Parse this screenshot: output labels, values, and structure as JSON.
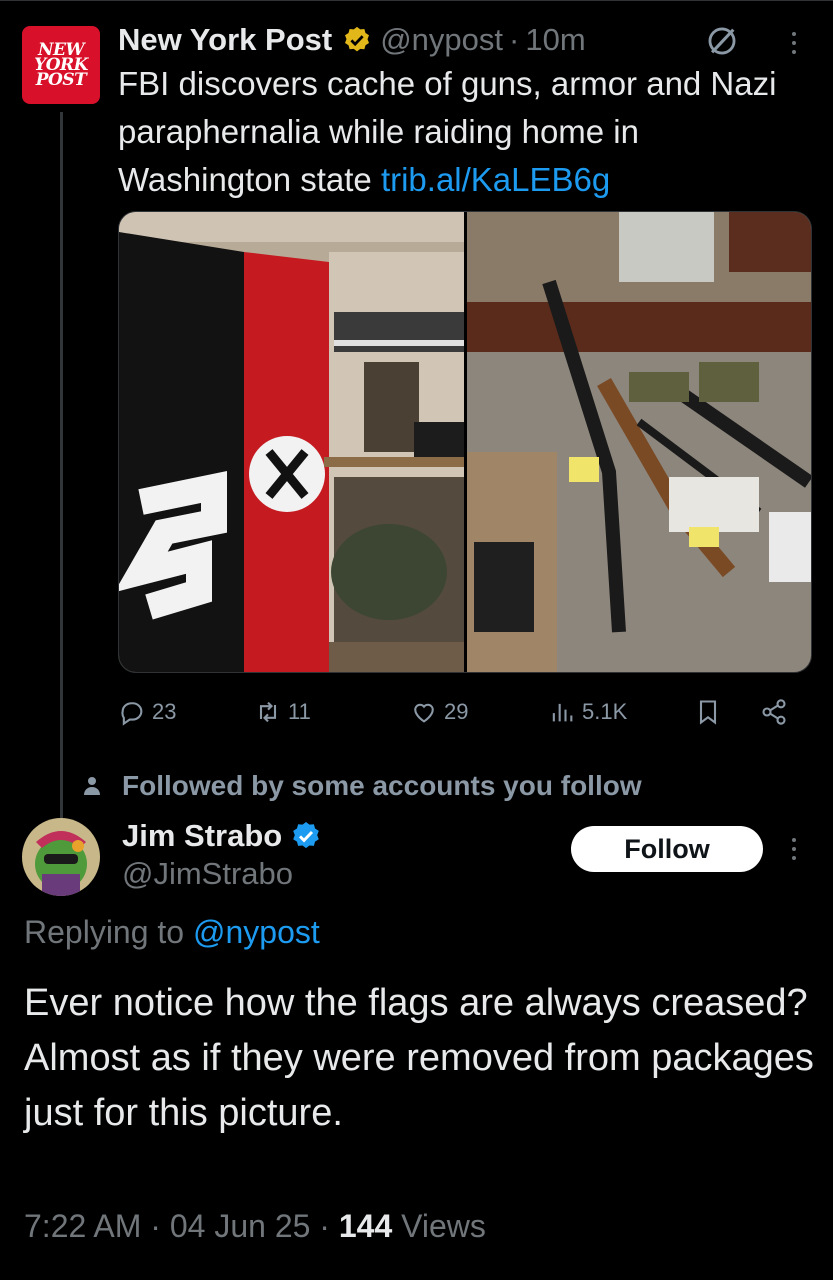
{
  "original_post": {
    "avatar_text": [
      "NEW",
      "YORK",
      "POST"
    ],
    "author_name": "New York Post",
    "handle": "@nypost",
    "separator": "·",
    "time": "10m",
    "text": "FBI discovers cache of guns, armor and Nazi paraphernalia while raiding home in Washington state",
    "link": "trib.al/KaLEB6g",
    "stats": {
      "replies": "23",
      "reposts": "11",
      "likes": "29",
      "views": "5.1K"
    }
  },
  "followed_notice": "Followed by some accounts you follow",
  "reply": {
    "author_name": "Jim Strabo",
    "handle": "@JimStrabo",
    "follow_label": "Follow",
    "replying_prefix": "Replying to",
    "replying_to": "@nypost",
    "text": "Ever notice how the flags are always creased? Almost as if they were removed from packages just for this picture.",
    "time": "7:22 AM",
    "date": "04 Jun 25",
    "separator": "·",
    "views_count": "144",
    "views_label": "Views"
  },
  "icons": {
    "verified_gold": "gold-verified-check-icon",
    "verified_blue": "blue-verified-check-icon",
    "grok": "grok-icon",
    "more": "more-vertical-icon",
    "reply": "reply-bubble-icon",
    "repost": "repost-icon",
    "like": "heart-icon",
    "views": "views-bars-icon",
    "bookmark": "bookmark-icon",
    "share": "share-icon",
    "person": "person-icon"
  },
  "colors": {
    "background": "#000000",
    "text_primary": "#e7e9ea",
    "text_secondary": "#71767b",
    "link": "#1d9bf0",
    "nypost_red": "#d8102a",
    "follow_button_bg": "#ffffff"
  }
}
